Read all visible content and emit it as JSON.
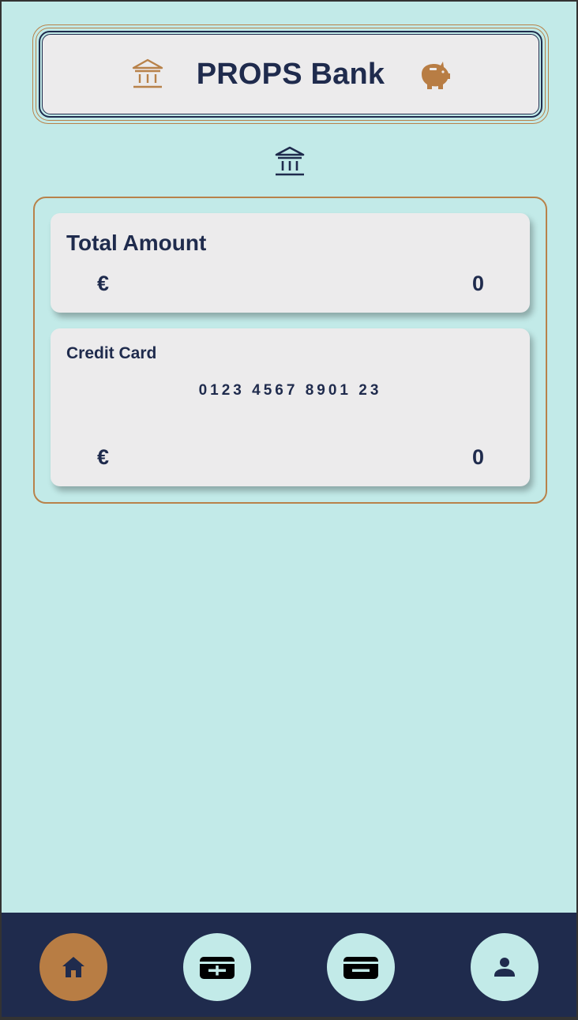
{
  "app": {
    "title": "PROPS Bank"
  },
  "colors": {
    "background": "#c2eae8",
    "navy": "#1f2b4d",
    "copper": "#b8824a",
    "card": "#ecebec"
  },
  "header": {
    "left_icon": "bank-icon",
    "right_icon": "piggy-bank-icon"
  },
  "section_icon": "bank-icon",
  "total_card": {
    "title": "Total Amount",
    "currency": "€",
    "amount": "0"
  },
  "credit_card": {
    "title": "Credit Card",
    "number": "0123 4567 8901 23",
    "currency": "€",
    "amount": "0"
  },
  "nav": {
    "active": "home",
    "items": [
      {
        "id": "home",
        "icon": "home-icon"
      },
      {
        "id": "deposit",
        "icon": "card-plus-icon"
      },
      {
        "id": "withdraw",
        "icon": "card-minus-icon"
      },
      {
        "id": "profile",
        "icon": "person-icon"
      }
    ]
  }
}
